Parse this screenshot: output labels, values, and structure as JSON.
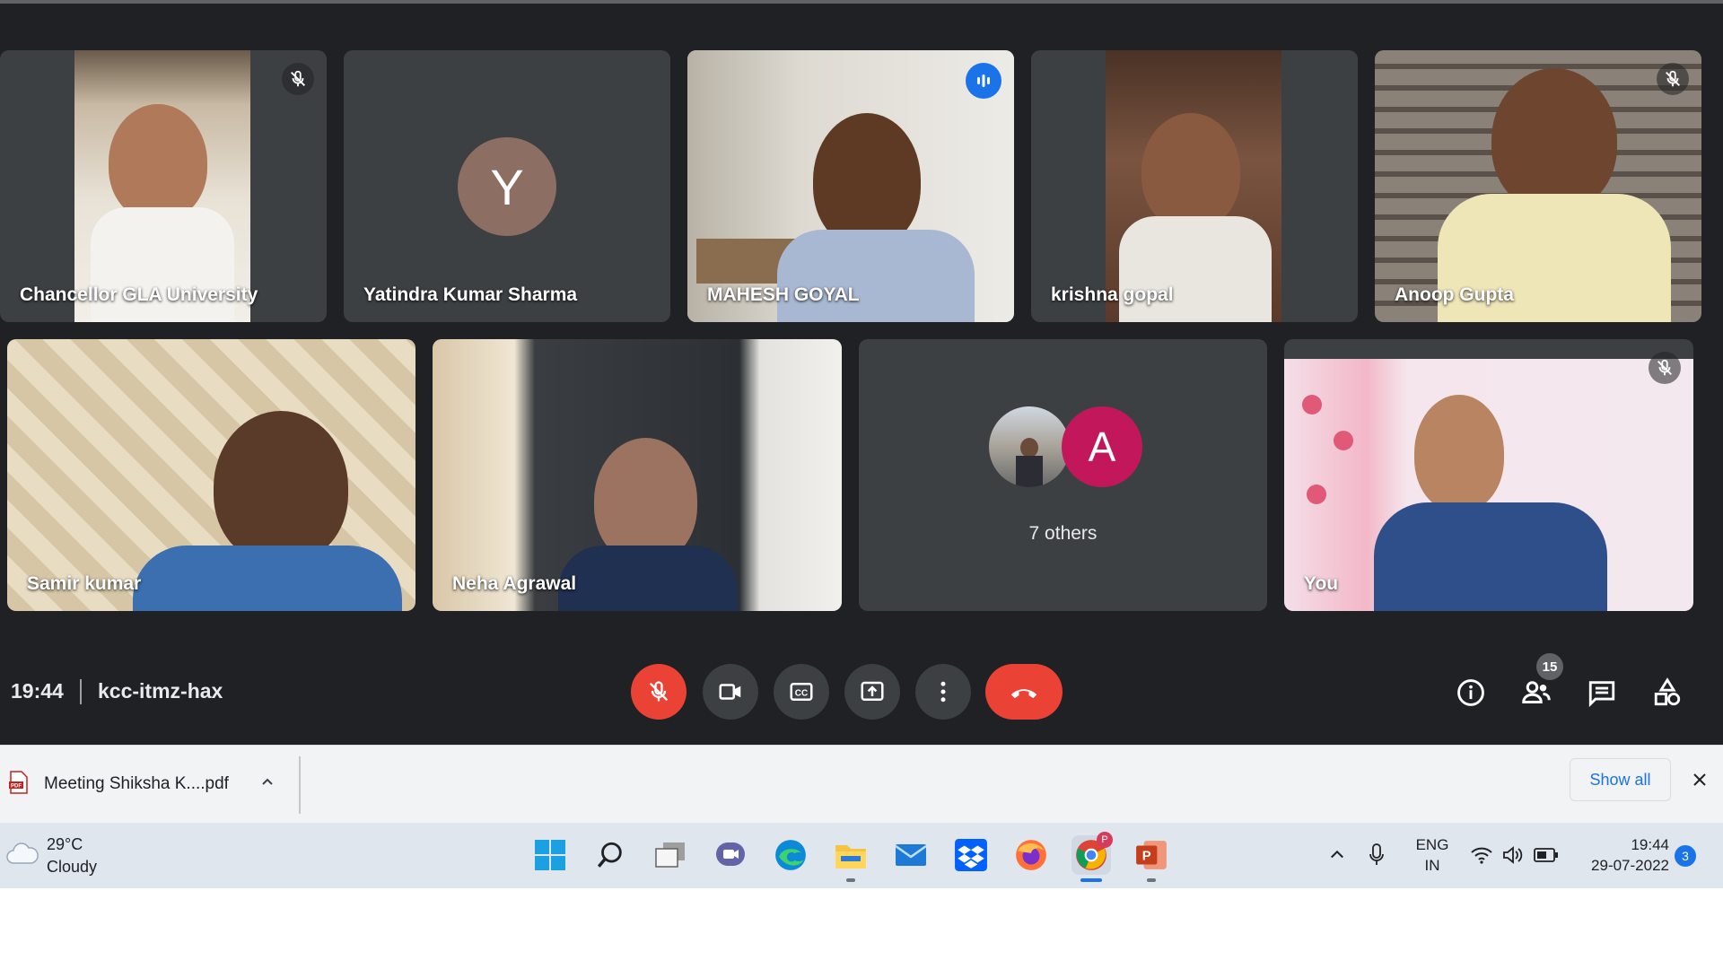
{
  "meeting": {
    "time": "19:44",
    "code": "kcc-itmz-hax",
    "participants_badge": "15"
  },
  "participants": [
    {
      "name": "Chancellor GLA University",
      "muted": true
    },
    {
      "name": "Yatindra Kumar Sharma",
      "initial": "Y",
      "avatar_color": "#8d6e63",
      "muted": false
    },
    {
      "name": "MAHESH GOYAL",
      "speaking": true
    },
    {
      "name": "krishna gopal",
      "muted": false
    },
    {
      "name": "Anoop Gupta",
      "muted": true
    },
    {
      "name": "Samir kumar",
      "muted": false
    },
    {
      "name": "Neha Agrawal",
      "muted": false
    },
    {
      "name": "You",
      "muted": true
    }
  ],
  "others": {
    "label": "7 others",
    "initial": "A",
    "avatar_color": "#c2185b"
  },
  "controls": {
    "mic": "mic-off-icon",
    "camera": "videocam-icon",
    "captions": "cc-icon",
    "present": "present-icon",
    "more": "more-vert-icon",
    "end_call": "call-end-icon",
    "info": "info-icon",
    "people": "people-icon",
    "chat": "chat-icon",
    "activities": "activities-icon"
  },
  "download": {
    "filename": "Meeting Shiksha K....pdf",
    "show_all": "Show all"
  },
  "taskbar": {
    "weather_temp": "29°C",
    "weather_desc": "Cloudy",
    "lang_line1": "ENG",
    "lang_line2": "IN",
    "time": "19:44",
    "date": "29-07-2022",
    "notifications": "3",
    "chrome_profile": "P"
  },
  "colors": {
    "meet_bg": "#202124",
    "tile_bg": "#3c4043",
    "speaking_outline": "#8ab4f8",
    "end_call": "#ea4335",
    "accent": "#1a73e8"
  }
}
